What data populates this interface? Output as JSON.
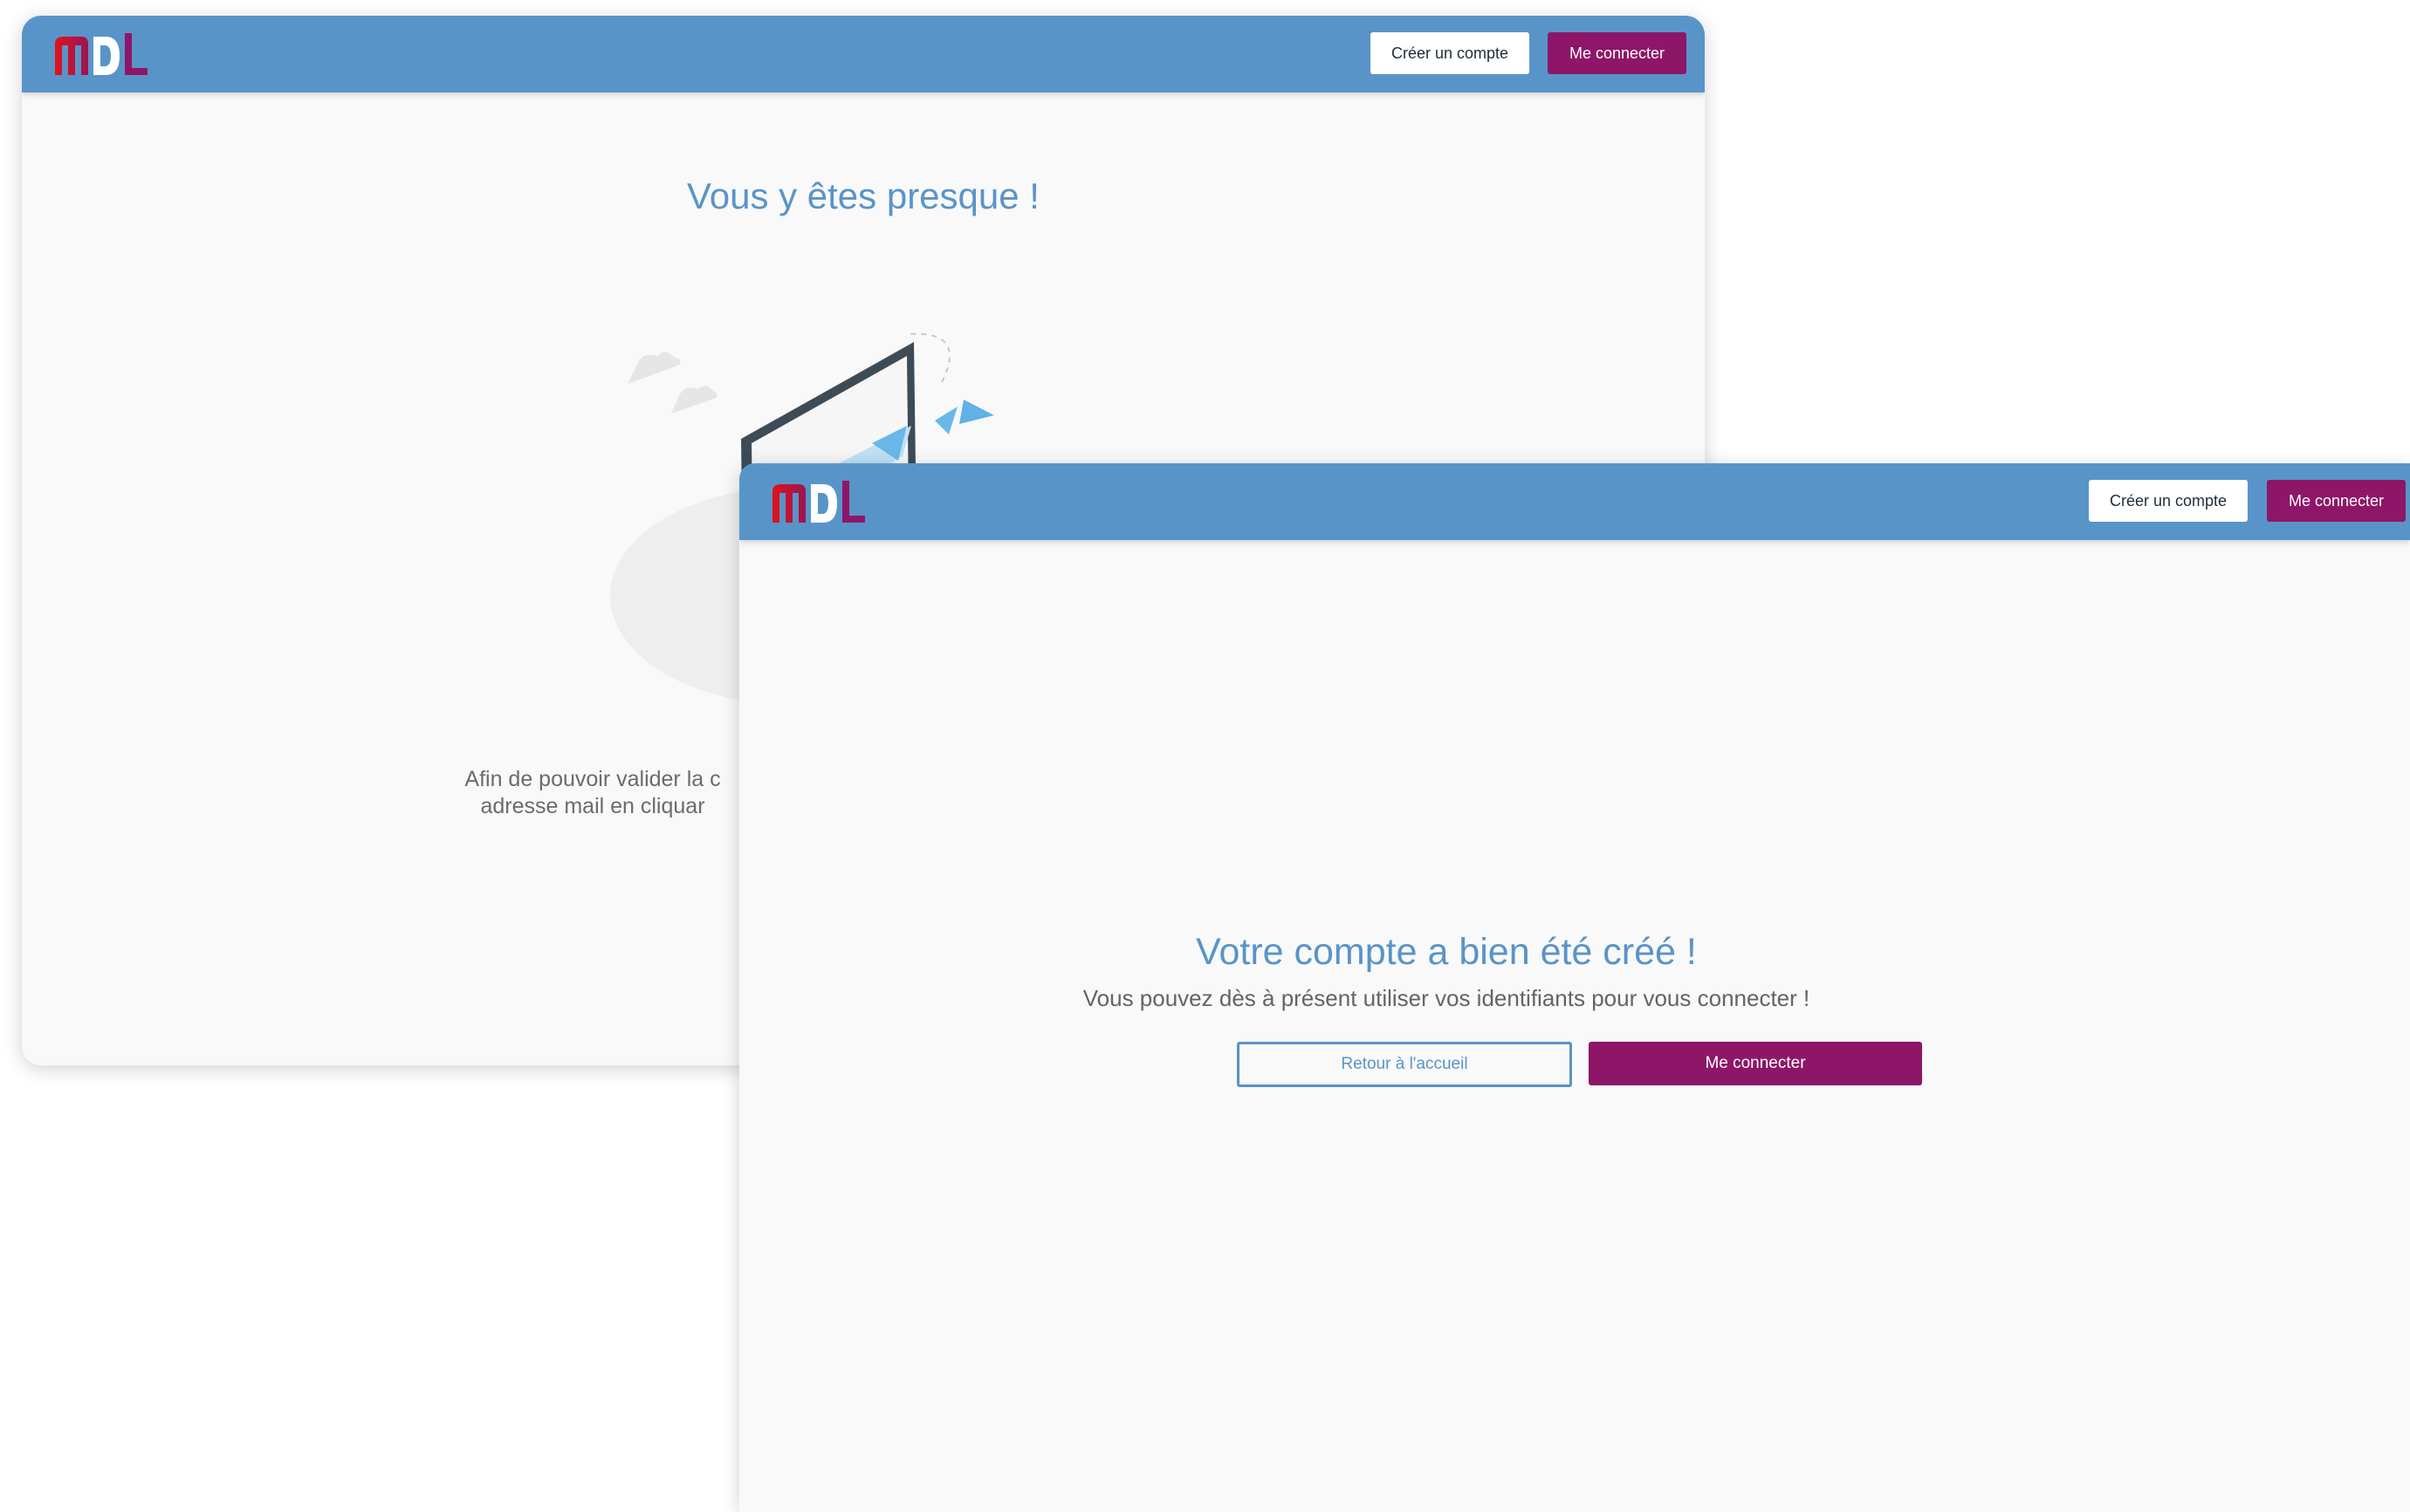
{
  "logo": {
    "text": "MDL"
  },
  "colors": {
    "header": "#5994c9",
    "accent_purple": "#8e1668",
    "title_blue": "#5994c9",
    "page_bg": "#f9f9f9"
  },
  "window1": {
    "header": {
      "create_account_label": "Créer un compte",
      "login_label": "Me connecter"
    },
    "title": "Vous y êtes presque !",
    "illustration_icon": "laptop-paper-plane-illustration",
    "body_line1": "Afin de pouvoir valider la c",
    "body_line2": "adresse mail en cliquar"
  },
  "window2": {
    "header": {
      "create_account_label": "Créer un compte",
      "login_label": "Me connecter"
    },
    "title": "Votre compte a bien été créé !",
    "subtitle": "Vous pouvez dès à présent utiliser vos identifiants pour vous connecter !",
    "home_button_label": "Retour à l'accueil",
    "login_button_label": "Me connecter"
  }
}
